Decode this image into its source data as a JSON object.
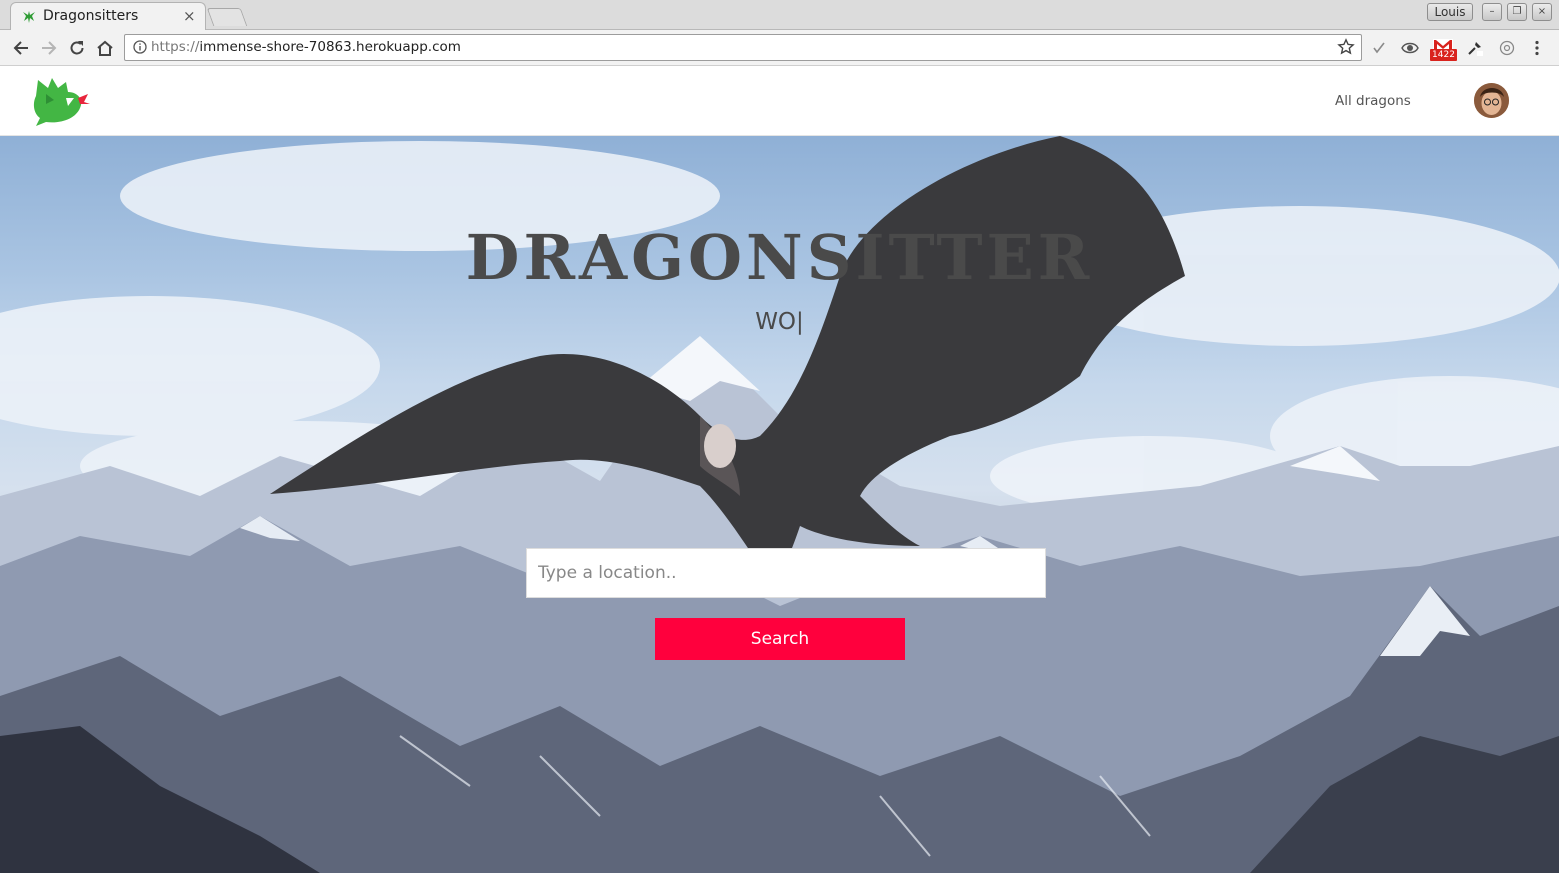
{
  "browser": {
    "tab": {
      "title": "Dragonsitters",
      "close": "×"
    },
    "profile": "Louis",
    "window_buttons": [
      "–",
      "❐",
      "×"
    ],
    "url": {
      "scheme": "https://",
      "host": "immense-shore-70863.herokuapp.com"
    },
    "extensions": {
      "gmail_badge": "1422"
    },
    "icons": [
      "back-arrow-icon",
      "forward-arrow-icon",
      "reload-icon",
      "home-icon",
      "info-icon",
      "star-icon",
      "checkmark-icon",
      "eye-icon",
      "gmail-icon",
      "eyedropper-icon",
      "circle-extension-icon",
      "kebab-menu-icon"
    ]
  },
  "navbar": {
    "links": [
      {
        "label": "All dragons"
      }
    ]
  },
  "hero": {
    "title": "DRAGONSITTER",
    "typed": "WO|",
    "search": {
      "placeholder": "Type a location..",
      "value": ""
    },
    "button": "Search"
  },
  "colors": {
    "accent": "#ff003d",
    "title": "#4a4a4a",
    "logo_green": "#3fb73f"
  }
}
